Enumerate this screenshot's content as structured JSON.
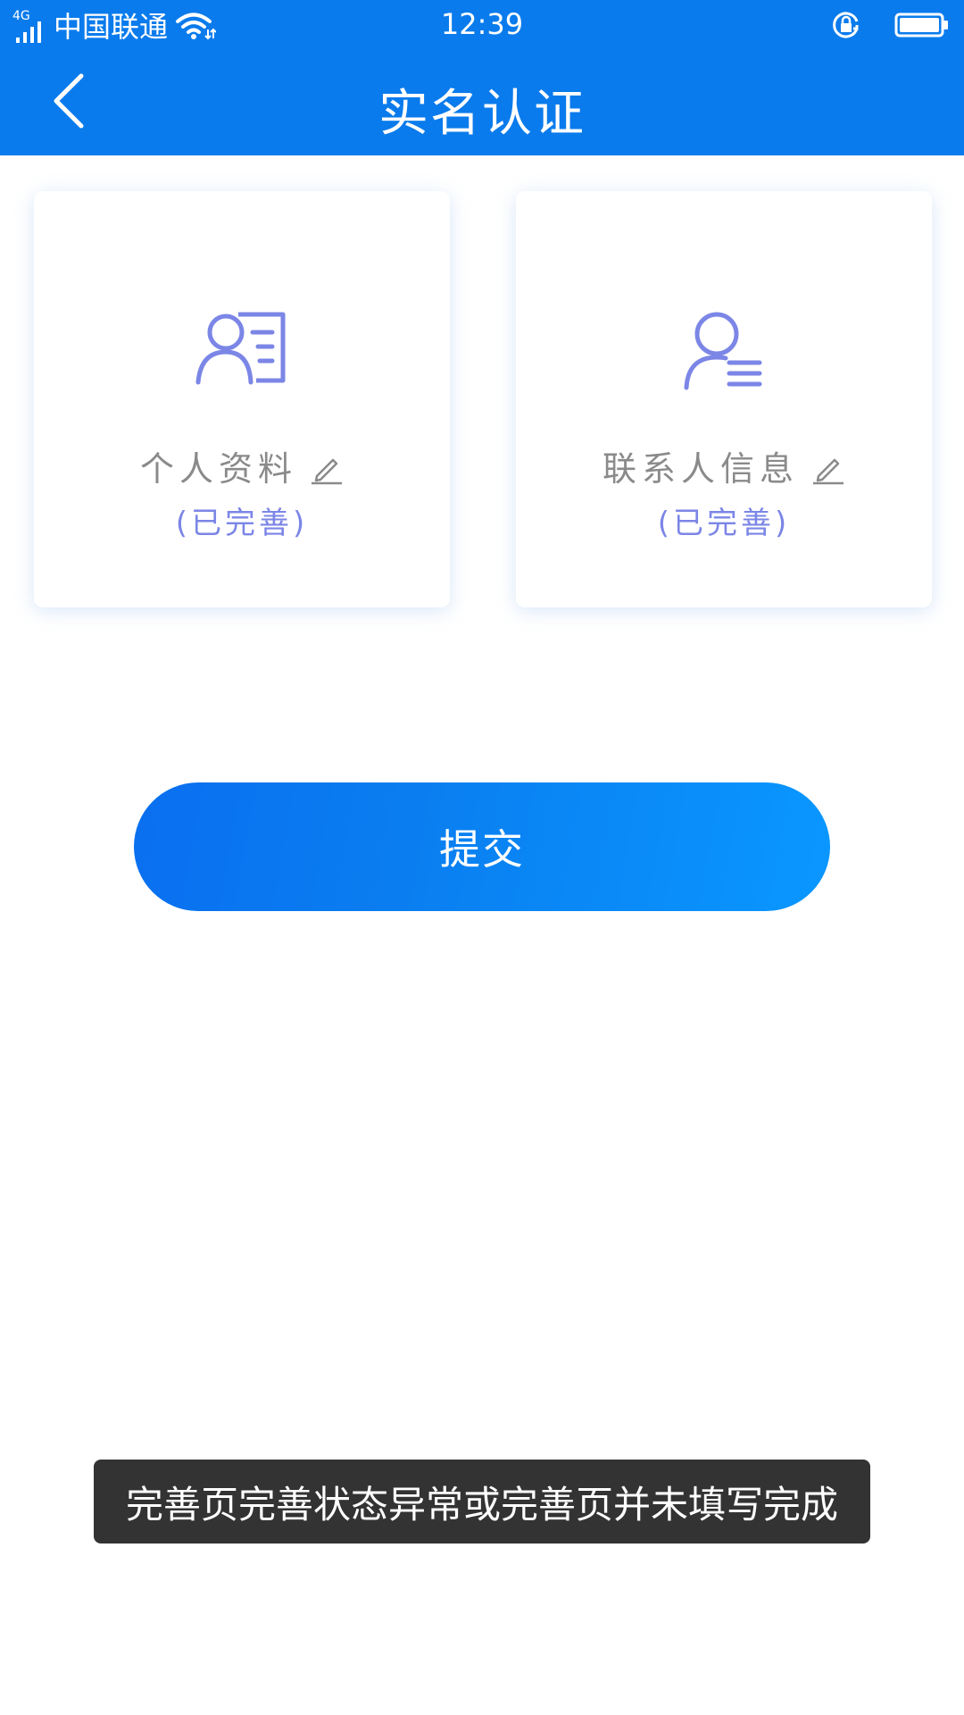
{
  "status_bar": {
    "network": "4G",
    "carrier": "中国联通",
    "time": "12:39",
    "icons": [
      "signal-icon",
      "wifi-icon",
      "rotation-lock-icon",
      "battery-icon"
    ]
  },
  "header": {
    "title": "实名认证",
    "back_icon": "chevron-left-icon",
    "background": "#0a7bec"
  },
  "cards": [
    {
      "icon": "id-card-person-icon",
      "title": "个人资料",
      "edit_icon": "pencil-icon",
      "status": "(已完善)"
    },
    {
      "icon": "contact-person-icon",
      "title": "联系人信息",
      "edit_icon": "pencil-icon",
      "status": "(已完善)"
    }
  ],
  "submit": {
    "label": "提交"
  },
  "toast": {
    "message": "完善页完善状态异常或完善页并未填写完成"
  },
  "colors": {
    "accent": "#0a7bec",
    "icon": "#7b86e6",
    "label": "#8a8a8a",
    "toast_bg": "#333333"
  }
}
